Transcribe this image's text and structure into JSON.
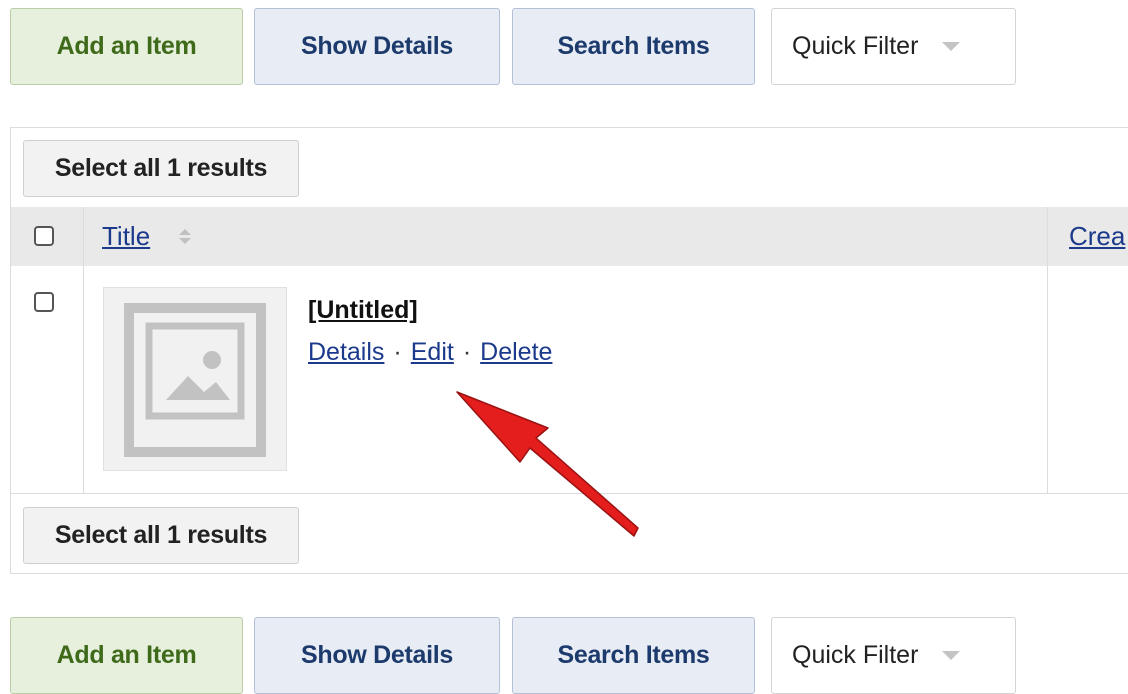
{
  "toolbar_top": {
    "add_label": "Add an Item",
    "show_details_label": "Show Details",
    "search_label": "Search Items",
    "quick_filter_label": "Quick Filter"
  },
  "results": {
    "select_all_label": "Select all 1 results",
    "columns": [
      "Title",
      "Crea"
    ],
    "rows": [
      {
        "title": "[Untitled]",
        "actions": [
          "Details",
          "Edit",
          "Delete"
        ],
        "separator": "·"
      }
    ]
  },
  "toolbar_bottom": {
    "add_label": "Add an Item",
    "show_details_label": "Show Details",
    "search_label": "Search Items",
    "quick_filter_label": "Quick Filter"
  },
  "icons": {
    "thumbnail": "image-placeholder-icon",
    "sort": "sort-icon",
    "dropdown": "chevron-down-icon",
    "annotation": "red-arrow"
  },
  "colors": {
    "add_bg": "#e6f0dc",
    "add_text": "#3e6a1a",
    "blue_bg": "#e7ecf5",
    "blue_text": "#1c3a6c",
    "link": "#1c3a8c",
    "arrow": "#e41d1d"
  }
}
